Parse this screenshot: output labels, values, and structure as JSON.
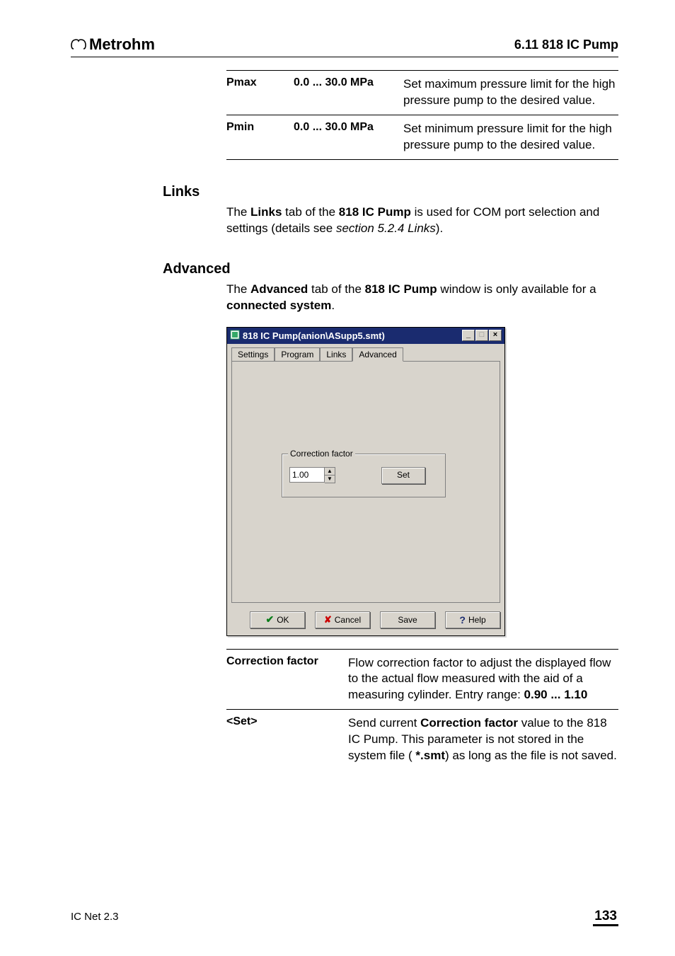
{
  "header": {
    "brand": "Metrohm",
    "section": "6.11  818 IC Pump"
  },
  "params": [
    {
      "name": "Pmax",
      "range": "0.0 ... 30.0 MPa",
      "desc": "Set maximum pressure limit for the high pressure pump to the desired value."
    },
    {
      "name": "Pmin",
      "range": "0.0 ... 30.0 MPa",
      "desc": "Set minimum pressure limit for the high pressure pump to the desired value."
    }
  ],
  "sections": {
    "links": {
      "heading": "Links",
      "p1a": "The ",
      "p1b": "Links",
      "p1c": " tab of the ",
      "p1d": "818 IC Pump",
      "p1e": " is used for COM port selection and settings (details see ",
      "p1f": "section 5.2.4 Links",
      "p1g": ")."
    },
    "advanced": {
      "heading": "Advanced",
      "p1a": "The ",
      "p1b": "Advanced",
      "p1c": " tab of the ",
      "p1d": "818 IC Pump",
      "p1e": " window is only available for a ",
      "p1f": "connected system",
      "p1g": "."
    }
  },
  "dialog": {
    "title": "818 IC Pump(anion\\ASupp5.smt)",
    "tabs": [
      "Settings",
      "Program",
      "Links",
      "Advanced"
    ],
    "group_label": "Correction factor",
    "correction_value": "1.00",
    "set_label": "Set",
    "buttons": {
      "ok": "OK",
      "cancel": "Cancel",
      "save": "Save",
      "help": "Help"
    }
  },
  "defs": [
    {
      "term": "Correction factor",
      "desc_a": "Flow correction factor to adjust the displayed flow to the actual flow measured with the aid of a measuring cylinder. Entry range: ",
      "desc_b": "0.90 ... 1.10"
    },
    {
      "term": "<Set>",
      "desc_a": "Send current ",
      "desc_b": "Correction factor",
      "desc_c": " value to the 818 IC Pump. This parameter is not stored in the system file (",
      "desc_d": "*.smt",
      "desc_e": ") as long as the file is not saved."
    }
  ],
  "footer": {
    "product": "IC Net 2.3",
    "page": "133"
  }
}
